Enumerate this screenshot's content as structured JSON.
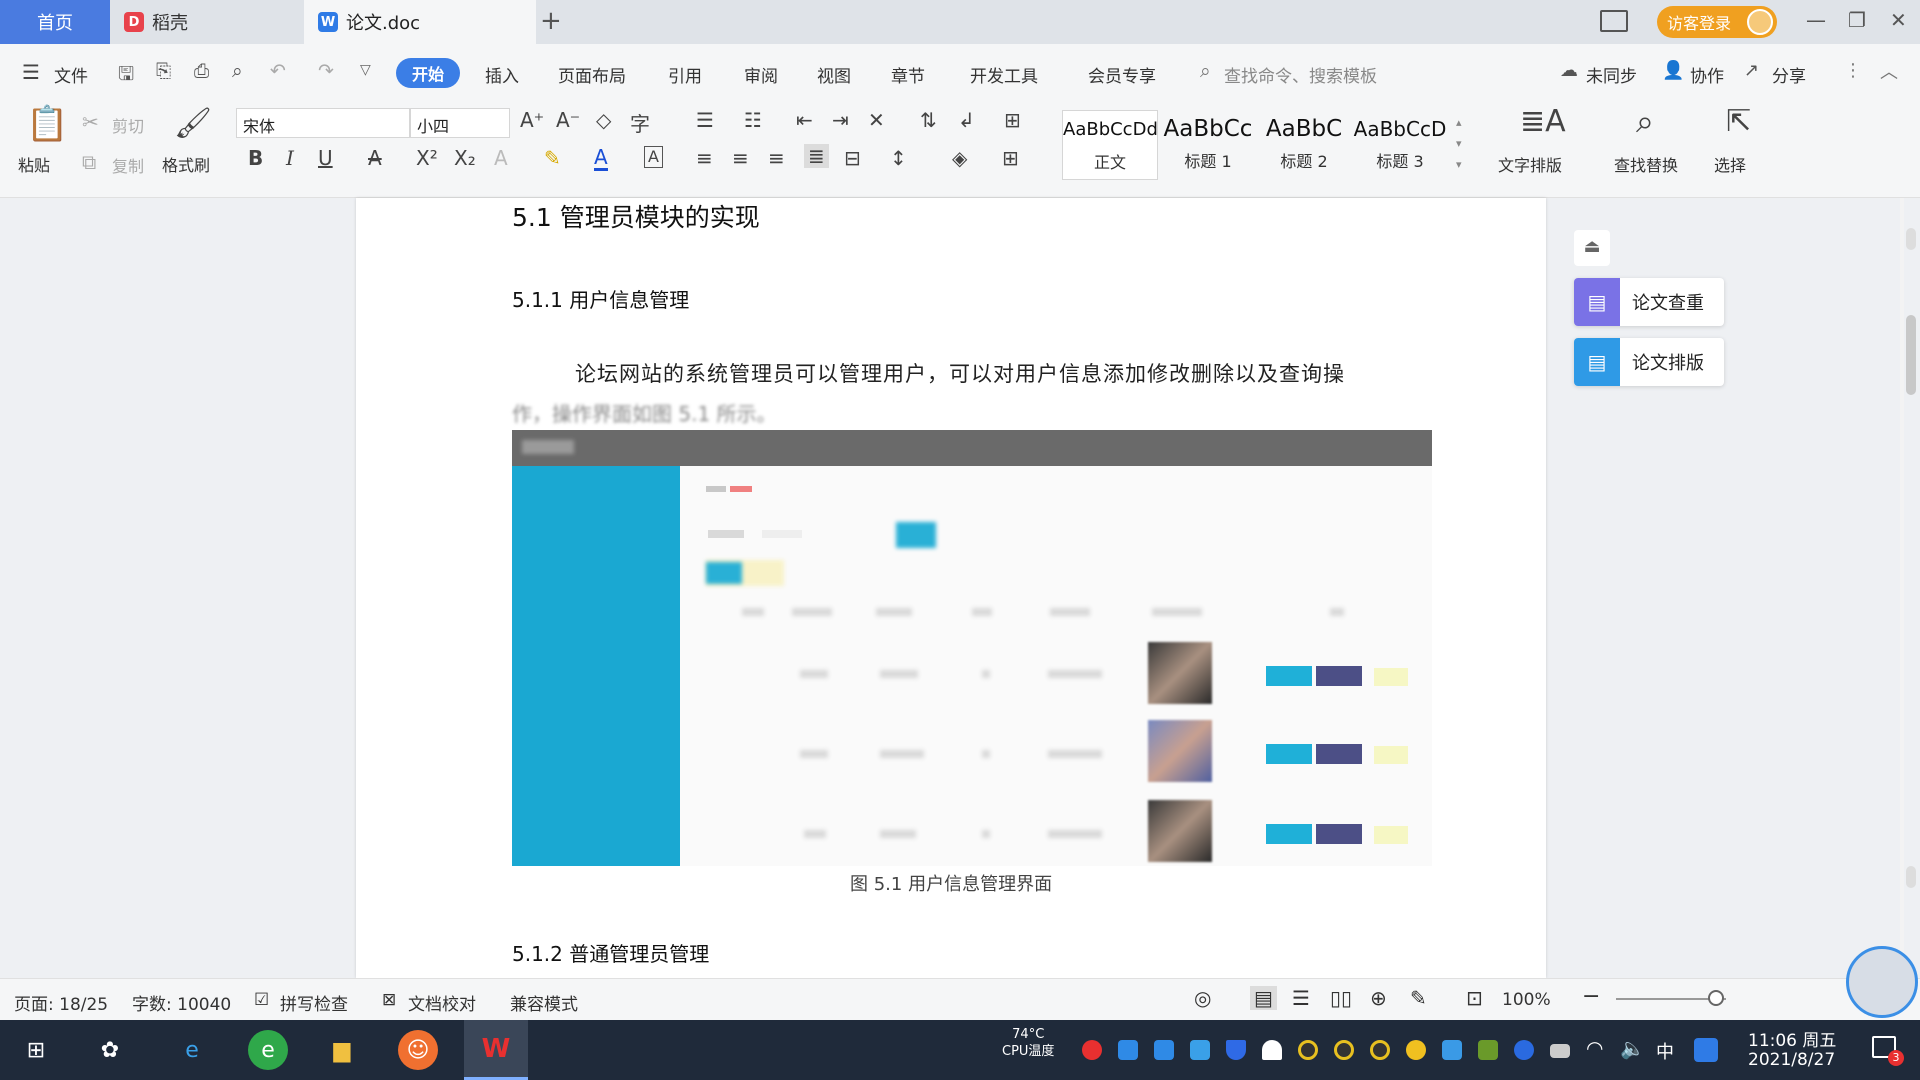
{
  "titlebar": {
    "tab_home": "首页",
    "tab_daoke": "稻壳",
    "tab_doc": "论文.doc",
    "new_tab": "+",
    "visitor_login": "访客登录"
  },
  "menu": {
    "file": "文件",
    "start": "开始",
    "insert": "插入",
    "layout": "页面布局",
    "reference": "引用",
    "review": "审阅",
    "view": "视图",
    "chapter": "章节",
    "devtools": "开发工具",
    "member": "会员专享",
    "search_placeholder": "查找命令、搜索模板",
    "sync": "未同步",
    "collab": "协作",
    "share": "分享"
  },
  "ribbon": {
    "paste": "粘贴",
    "cut": "剪切",
    "copy": "复制",
    "format_painter": "格式刷",
    "font_name": "宋体",
    "font_size": "小四",
    "styles": [
      {
        "preview": "AaBbCcDd",
        "label": "正文"
      },
      {
        "preview": "AaBbCc",
        "label": "标题 1"
      },
      {
        "preview": "AaBbC",
        "label": "标题 2"
      },
      {
        "preview": "AaBbCcD",
        "label": "标题 3"
      }
    ],
    "text_layout": "文字排版",
    "find_replace": "查找替换",
    "select": "选择"
  },
  "document": {
    "heading_51": "5.1  管理员模块的实现",
    "heading_511": "5.1.1  用户信息管理",
    "paragraph": "论坛网站的系统管理员可以管理用户，可以对用户信息添加修改删除以及查询操",
    "paragraph_cont": "作，操作界面如图 5.1 所示。",
    "figure_caption": "图 5.1  用户信息管理界面",
    "heading_512": "5.1.2  普通管理员管理"
  },
  "right_panel": {
    "check": "论文查重",
    "format": "论文排版"
  },
  "status": {
    "page": "页面: 18/25",
    "words": "字数: 10040",
    "spellcheck": "拼写检查",
    "proofread": "文档校对",
    "compat": "兼容模式",
    "zoom": "100%",
    "zoom_level": 1.0
  },
  "taskbar": {
    "cpu_temp": "74°C",
    "cpu_label": "CPU温度",
    "time": "11:06 周五",
    "date": "2021/8/27",
    "ime": "中",
    "notifications": "3"
  },
  "colors": {
    "accent": "#3b7ee6",
    "home_tab": "#4a7be0",
    "visitor": "#f0a020",
    "figure_sidebar": "#1aa8d2"
  }
}
